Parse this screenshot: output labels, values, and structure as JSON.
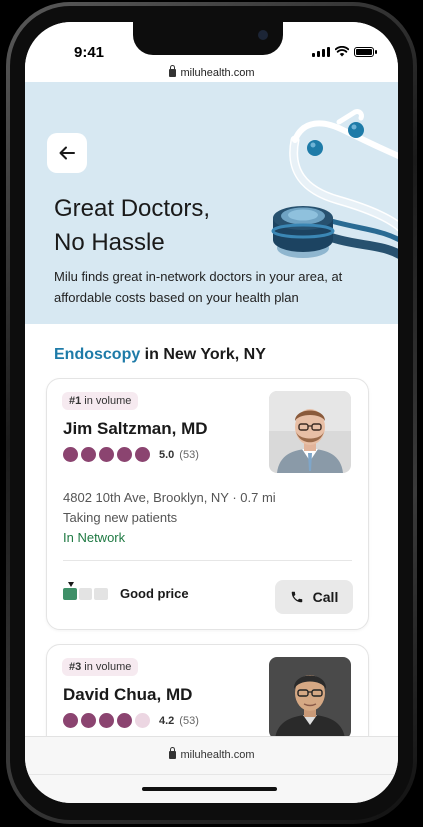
{
  "status": {
    "time": "9:41"
  },
  "browser": {
    "url_top": "miluhealth.com",
    "url_bottom": "miluhealth.com"
  },
  "hero": {
    "title_line1": "Great Doctors,",
    "title_line2": "No Hassle",
    "subtitle": "Milu finds great in-network doctors in your area, at affordable costs based on your health plan"
  },
  "search": {
    "specialty": "Endoscopy",
    "connector": " in ",
    "location": "New York, NY"
  },
  "doctors": [
    {
      "rank": "#1",
      "rank_suffix": " in volume",
      "name": "Jim Saltzman, MD",
      "rating": 5,
      "rating_label": "5.0",
      "reviews": "(53)",
      "address": "4802 10th Ave, Brooklyn, NY · 0.7 mi",
      "availability": "Taking new patients",
      "network": "In Network",
      "price_label": "Good price",
      "price_level": 1,
      "call_label": "Call"
    },
    {
      "rank": "#3",
      "rank_suffix": " in volume",
      "name": "David Chua, MD",
      "rating": 4,
      "rating_label": "4.2",
      "reviews": "(53)"
    }
  ],
  "colors": {
    "hero_bg": "#d7e8f2",
    "accent": "#1e7ba8",
    "rating": "#8b4470",
    "network": "#1f7a43",
    "price": "#3f9068"
  },
  "icons": [
    "back-arrow-icon",
    "stethoscope-illustration",
    "phone-icon",
    "lock-icon"
  ]
}
